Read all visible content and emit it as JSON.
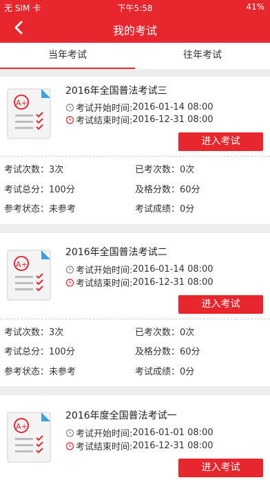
{
  "statusbar": {
    "carrier": "无 SIM 卡",
    "time": "下午5:58",
    "battery": "41%"
  },
  "nav": {
    "title": "我的考试"
  },
  "tabs": [
    {
      "label": "当年考试"
    },
    {
      "label": "往年考试"
    }
  ],
  "labels": {
    "start_prefix": "考试开始时间:",
    "end_prefix": "考试结束时间:",
    "enter_button": "进入考试",
    "times_label": "考试次数：",
    "taken_label": "已考次数：",
    "total_label": "考试总分：",
    "pass_label": "及格分数：",
    "status_label": "参考状态：",
    "score_label": "考试成绩："
  },
  "exams": [
    {
      "title": "2016年全国普法考试三",
      "start": "2016-01-14 08:00",
      "end": "2016-12-31 08:00",
      "times": "3次",
      "taken": "0次",
      "total": "100分",
      "pass": "60分",
      "status": "未参考",
      "score": "0分"
    },
    {
      "title": "2016年全国普法考试二",
      "start": "2016-01-14 08:00",
      "end": "2016-12-31 08:00",
      "times": "3次",
      "taken": "0次",
      "total": "100分",
      "pass": "60分",
      "status": "未参考",
      "score": "0分"
    },
    {
      "title": "2016年度全国普法考试一",
      "start": "2016-01-01 08:00",
      "end": "2016-12-31 08:00"
    }
  ]
}
